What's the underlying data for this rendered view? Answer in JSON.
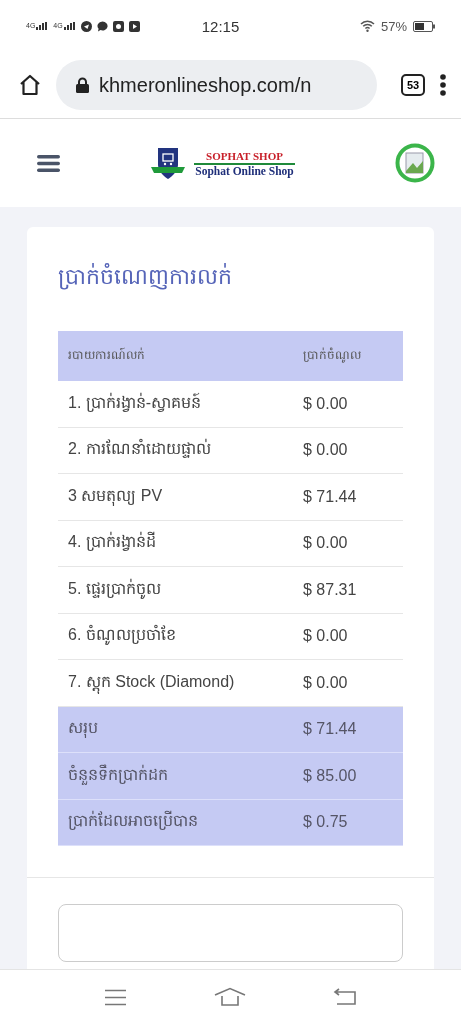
{
  "status_bar": {
    "signals": [
      "4G",
      "4G"
    ],
    "time": "12:15",
    "battery": "57%"
  },
  "browser": {
    "url": "khmeronlineshop.com/n",
    "tab_count": "53"
  },
  "site_header": {
    "logo_title": "SOPHAT SHOP",
    "logo_subtitle": "Sophat Online Shop"
  },
  "card": {
    "title": "ប្រាក់ចំណេញការលក់",
    "table": {
      "columns": [
        "របាយការណ៍លក់",
        "ប្រាក់ចំណូល"
      ],
      "rows": [
        {
          "kind": "item",
          "label": "1. ប្រាក់រង្វាន់-ស្វាគមន៍",
          "amount": "$ 0.00"
        },
        {
          "kind": "item",
          "label": "2. ការណែនាំដោយផ្ទាល់",
          "amount": "$ 0.00"
        },
        {
          "kind": "item",
          "label": "3 សមតុល្យ PV",
          "amount": "$ 71.44"
        },
        {
          "kind": "item",
          "label": "4. ប្រាក់រង្វាន់ដី",
          "amount": "$ 0.00"
        },
        {
          "kind": "item",
          "label": "5. ផ្ទេរប្រាក់ចូល",
          "amount": "$ 87.31"
        },
        {
          "kind": "item",
          "label": "6. ចំណូលប្រចាំខែ",
          "amount": "$ 0.00"
        },
        {
          "kind": "item",
          "label": "7. ស្តុក Stock (Diamond)",
          "amount": "$ 0.00"
        },
        {
          "kind": "summary",
          "label": "សរុប",
          "amount": "$ 71.44"
        },
        {
          "kind": "summary",
          "label": "ចំនួនទឹកប្រាក់ដក",
          "amount": "$ 85.00"
        },
        {
          "kind": "summary",
          "label": "ប្រាក់ដែលអាចប្រើបាន",
          "amount": "$ 0.75"
        }
      ]
    }
  }
}
